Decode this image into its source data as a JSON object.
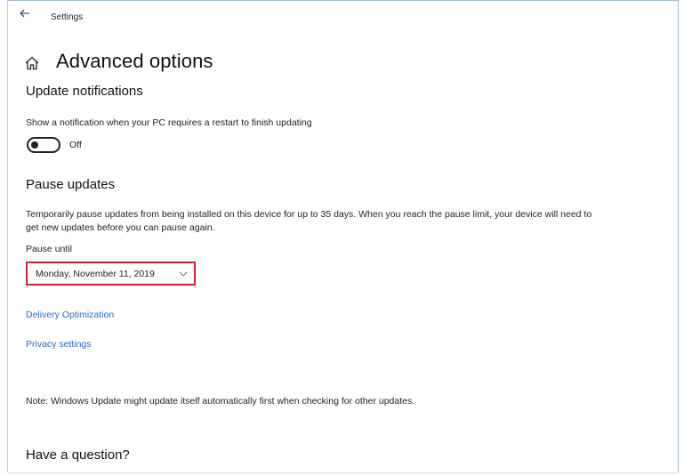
{
  "titlebar": {
    "title": "Settings",
    "back_icon": "back-arrow-icon"
  },
  "page": {
    "title": "Advanced options",
    "home_icon": "home-icon"
  },
  "update_notifications": {
    "heading": "Update notifications",
    "description": "Show a notification when your PC requires a restart to finish updating",
    "toggle_state": "Off",
    "toggle_on": false
  },
  "pause_updates": {
    "heading": "Pause updates",
    "description": "Temporarily pause updates from being installed on this device for up to 35 days. When you reach the pause limit, your device will need to get new updates before you can pause again.",
    "pause_until_label": "Pause until",
    "selected_date": "Monday, November 11, 2019",
    "highlight_color": "#d21f3c"
  },
  "links": {
    "delivery_optimization": "Delivery Optimization",
    "privacy_settings": "Privacy settings",
    "color": "#2b6cb8"
  },
  "note": "Note: Windows Update might update itself automatically first when checking for other updates.",
  "question": {
    "heading": "Have a question?"
  }
}
